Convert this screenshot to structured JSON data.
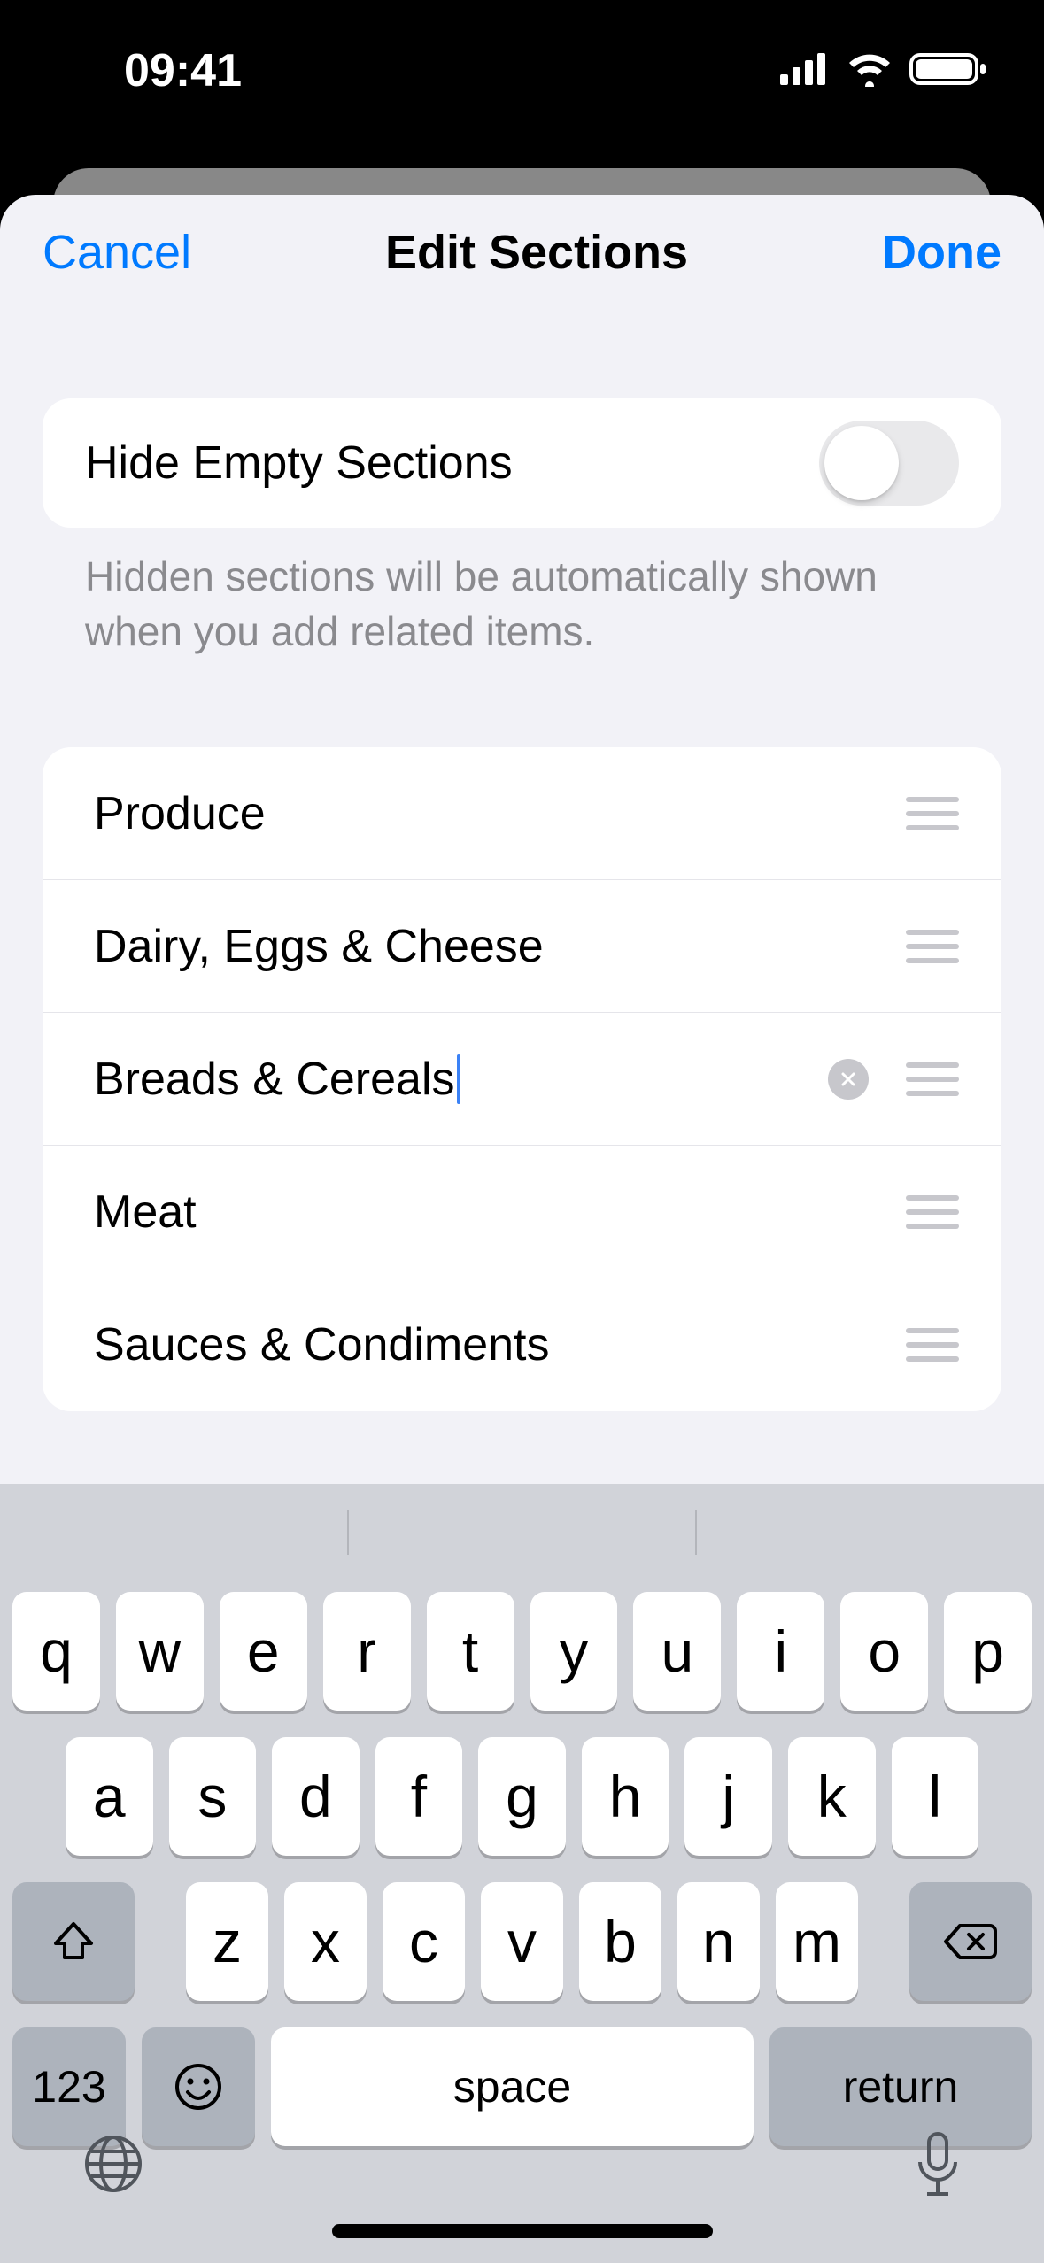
{
  "status": {
    "time": "09:41"
  },
  "nav": {
    "cancel": "Cancel",
    "title": "Edit Sections",
    "done": "Done"
  },
  "hide_empty": {
    "label": "Hide Empty Sections",
    "footer": "Hidden sections will be automatically shown when you add related items."
  },
  "sections": [
    {
      "name": "Produce",
      "editing": false
    },
    {
      "name": "Dairy, Eggs & Cheese",
      "editing": false
    },
    {
      "name": "Breads & Cereals",
      "editing": true
    },
    {
      "name": "Meat",
      "editing": false
    },
    {
      "name": "Sauces & Condiments",
      "editing": false
    }
  ],
  "keyboard": {
    "row1": [
      "q",
      "w",
      "e",
      "r",
      "t",
      "y",
      "u",
      "i",
      "o",
      "p"
    ],
    "row2": [
      "a",
      "s",
      "d",
      "f",
      "g",
      "h",
      "j",
      "k",
      "l"
    ],
    "row3": [
      "z",
      "x",
      "c",
      "v",
      "b",
      "n",
      "m"
    ],
    "k123": "123",
    "space": "space",
    "return": "return"
  }
}
